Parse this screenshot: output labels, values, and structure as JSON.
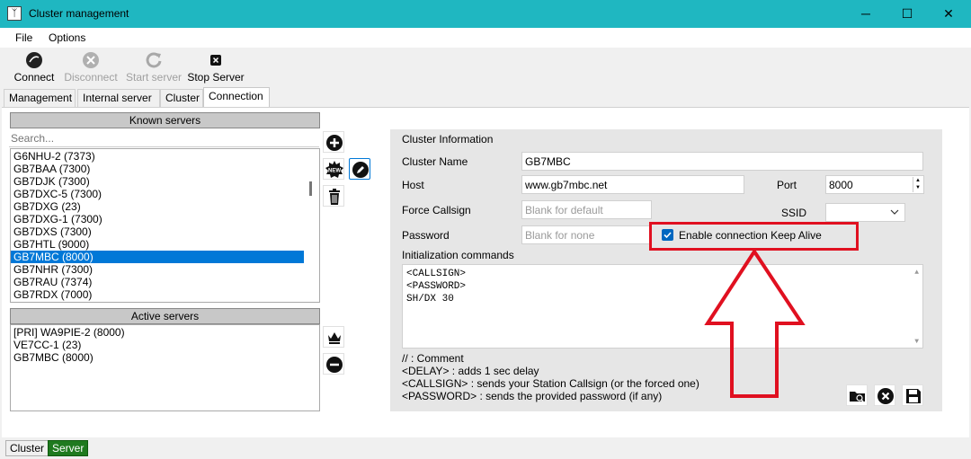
{
  "window": {
    "title": "Cluster management",
    "controls": [
      "─",
      "☐",
      "✕"
    ]
  },
  "menu": {
    "file": "File",
    "options": "Options"
  },
  "toolbar": {
    "connect": "Connect",
    "disconnect": "Disconnect",
    "start_server": "Start server",
    "stop_server": "Stop Server"
  },
  "tabs": [
    "Management",
    "Internal server",
    "Cluster",
    "Connection"
  ],
  "active_tab": "Connection",
  "known_servers": {
    "header": "Known servers",
    "search_placeholder": "Search...",
    "items": [
      "G6NHU-2 (7373)",
      "GB7BAA (7300)",
      "GB7DJK (7300)",
      "GB7DXC-5 (7300)",
      "GB7DXG (23)",
      "GB7DXG-1 (7300)",
      "GB7DXS (7300)",
      "GB7HTL (9000)",
      "GB7MBC (8000)",
      "GB7NHR (7300)",
      "GB7RAU (7374)",
      "GB7RDX (7000)"
    ],
    "selected": "GB7MBC (8000)"
  },
  "active_servers": {
    "header": "Active servers",
    "items": [
      "[PRI] WA9PIE-2 (8000)",
      "VE7CC-1 (23)",
      "GB7MBC (8000)"
    ]
  },
  "cluster_info": {
    "section_title": "Cluster Information",
    "name_label": "Cluster Name",
    "name_value": "GB7MBC",
    "host_label": "Host",
    "host_value": "www.gb7mbc.net",
    "port_label": "Port",
    "port_value": "8000",
    "force_callsign_label": "Force Callsign",
    "force_callsign_placeholder": "Blank for default",
    "ssid_label": "SSID",
    "ssid_value": "",
    "password_label": "Password",
    "password_placeholder": "Blank for none",
    "keepalive_label": "Enable connection Keep Alive",
    "keepalive_checked": true,
    "init_label": "Initialization commands",
    "init_lines": [
      "<CALLSIGN>",
      "<PASSWORD>",
      "SH/DX 30"
    ],
    "help_lines": [
      "// : Comment",
      "<DELAY> : adds 1 sec delay",
      "<CALLSIGN> : sends your Station Callsign (or the forced one)",
      "<PASSWORD> : sends the provided password (if any)"
    ]
  },
  "status_tabs": [
    "Cluster",
    "Server"
  ],
  "colors": {
    "titlebar": "#1fb7c1",
    "selection": "#0078d7",
    "annotation": "#e01020",
    "server_tab": "#1f7a1f"
  }
}
